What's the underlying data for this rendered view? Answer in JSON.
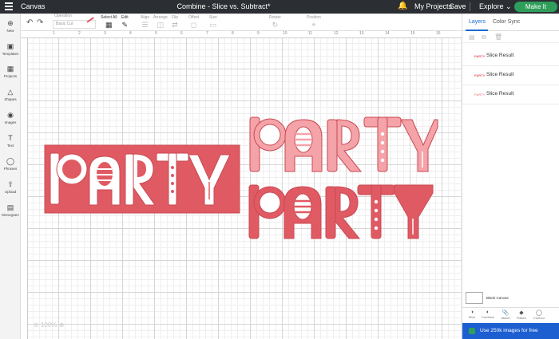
{
  "header": {
    "app_title": "Canvas",
    "document_title": "Combine - Slice vs. Subtract*",
    "my_projects": "My Projects",
    "save": "Save",
    "explore": "Explore",
    "make_it": "Make It"
  },
  "toolbar": {
    "linetype_label": "Operation",
    "linetype_value": "Basic Cut",
    "select_all": "Select All",
    "edit": "Edit",
    "align": "Align",
    "arrange": "Arrange",
    "flip": "Flip",
    "offset": "Offset",
    "size": "Size",
    "rotate": "Rotate",
    "position": "Position"
  },
  "left_sidebar": {
    "items": [
      {
        "label": "New",
        "icon": "plus-circle-icon"
      },
      {
        "label": "Templates",
        "icon": "shirt-icon"
      },
      {
        "label": "Projects",
        "icon": "grid-icon"
      },
      {
        "label": "Shapes",
        "icon": "shapes-icon"
      },
      {
        "label": "Images",
        "icon": "lightbulb-icon"
      },
      {
        "label": "Text",
        "icon": "text-icon"
      },
      {
        "label": "Phrases",
        "icon": "speech-bubble-icon"
      },
      {
        "label": "Upload",
        "icon": "upload-icon"
      },
      {
        "label": "Monogram",
        "icon": "monogram-icon"
      }
    ]
  },
  "ruler": {
    "ticks": [
      "1",
      "2",
      "3",
      "4",
      "5",
      "6",
      "7",
      "8",
      "9",
      "10",
      "11",
      "12",
      "13",
      "14",
      "15",
      "16",
      "17"
    ]
  },
  "canvas": {
    "zoom": "100%",
    "word": "PARTY",
    "colors": {
      "red": "#e05a63",
      "pink": "#f4a3a8",
      "outline": "#c94a53"
    }
  },
  "right_panel": {
    "tabs": [
      "Layers",
      "Color Sync"
    ],
    "active_tab": "Layers",
    "layers": [
      {
        "name": "Slice Result",
        "thumb": "PARTY"
      },
      {
        "name": "Slice Result",
        "thumb": "PARTY"
      },
      {
        "name": "Slice Result",
        "thumb": "PARTY"
      }
    ],
    "blank_canvas": "Blank Canvas",
    "tools": [
      "Slice",
      "Combine",
      "Attach",
      "Flatten",
      "Contour"
    ],
    "promo": "Use 250k images for free"
  }
}
